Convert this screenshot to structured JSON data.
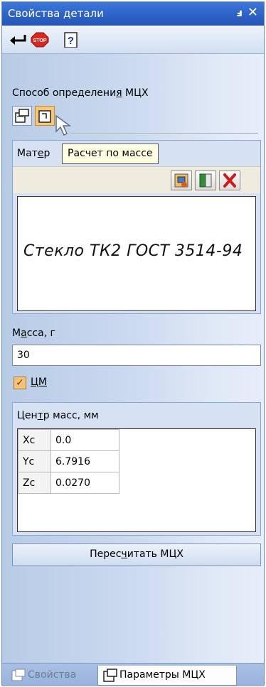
{
  "window": {
    "title": "Свойства детали",
    "pin_glyph": "ⅎ",
    "close_glyph": "✕"
  },
  "toolbar": {
    "icons": [
      "enter-arrow-icon",
      "stop-icon",
      "help-icon"
    ],
    "stop_text": "STOP"
  },
  "method": {
    "label_before": "Способ определени",
    "label_u": "я",
    "label_after": " МЦХ",
    "buttons": [
      "by-density-icon",
      "by-mass-icon"
    ],
    "active_index": 1
  },
  "tooltip": {
    "text": "Расчет по массе"
  },
  "material": {
    "head_before": "Мат",
    "head_u": "е",
    "head_after": "р",
    "value": "Стекло ТК2  ГОСТ 3514-94"
  },
  "mass": {
    "label_before": "М",
    "label_u": "а",
    "label_after": "сса, г",
    "value": "30"
  },
  "cm_checkbox": {
    "checked": true,
    "label": "ЦМ"
  },
  "center_of_mass": {
    "title_before": "Цен",
    "title_u": "т",
    "title_after": "р масс, мм",
    "rows": [
      {
        "key": "Xc",
        "value": "0.0"
      },
      {
        "key": "Yc",
        "value": "6.7916"
      },
      {
        "key": "Zc",
        "value": "0.0270"
      }
    ]
  },
  "recalc_button": {
    "before": "Перес",
    "u": "ч",
    "after": "итать МЦХ"
  },
  "tabs": [
    {
      "label": "Свойства",
      "active": false
    },
    {
      "label": "Параметры МЦХ",
      "active": true
    }
  ],
  "colors": {
    "title_bar": "#2d62c7",
    "accent_active": "#f6c878",
    "tooltip_bg": "#ffffe1"
  }
}
